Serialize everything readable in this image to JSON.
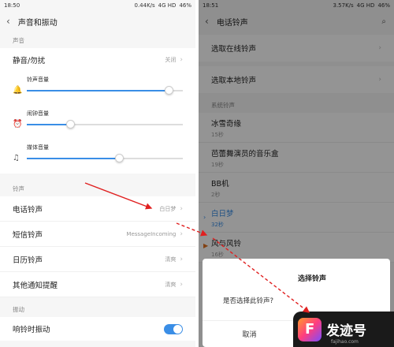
{
  "left": {
    "status": {
      "time": "18:50",
      "speed": "0.44K/s",
      "network": "4G HD",
      "battery": "46%"
    },
    "title": "声音和振动",
    "section_sound": "声音",
    "dnd": {
      "label": "静音/勿扰",
      "value": "关闭"
    },
    "sliders": [
      {
        "label": "铃声音量",
        "icon": "bell-icon",
        "level": 0.91
      },
      {
        "label": "闹钟音量",
        "icon": "alarm-clock-icon",
        "level": 0.28
      },
      {
        "label": "媒体音量",
        "icon": "music-note-icon",
        "level": 0.59
      }
    ],
    "section_ringtone": "铃声",
    "ringtones": [
      {
        "label": "电话铃声",
        "value": "白日梦"
      },
      {
        "label": "短信铃声",
        "value": "MessageIncoming"
      },
      {
        "label": "日历铃声",
        "value": "清爽"
      },
      {
        "label": "其他通知提醒",
        "value": "清爽"
      }
    ],
    "section_vibrate": "振动",
    "vibrate": {
      "label": "响铃时振动",
      "on": true
    }
  },
  "right": {
    "status": {
      "time": "18:51",
      "speed": "3.57K/s",
      "network": "4G HD",
      "battery": "46%"
    },
    "title": "电话铃声",
    "online": "选取在线铃声",
    "local": "选取本地铃声",
    "section": "系统铃声",
    "items": [
      {
        "title": "冰雪奇缘",
        "dur": "15秒"
      },
      {
        "title": "芭蕾舞演员的音乐盒",
        "dur": "19秒"
      },
      {
        "title": "BB机",
        "dur": "2秒"
      },
      {
        "title": "白日梦",
        "dur": "32秒"
      },
      {
        "title": "风与风铃",
        "dur": "16秒"
      }
    ],
    "dialog": {
      "title": "选择铃声",
      "message": "是否选择此铃声?",
      "cancel": "取消"
    }
  },
  "watermark": {
    "name": "发迹号",
    "url": "fajihao.com"
  },
  "colors": {
    "accent": "#3a8ee6",
    "arrow": "#e02020"
  }
}
